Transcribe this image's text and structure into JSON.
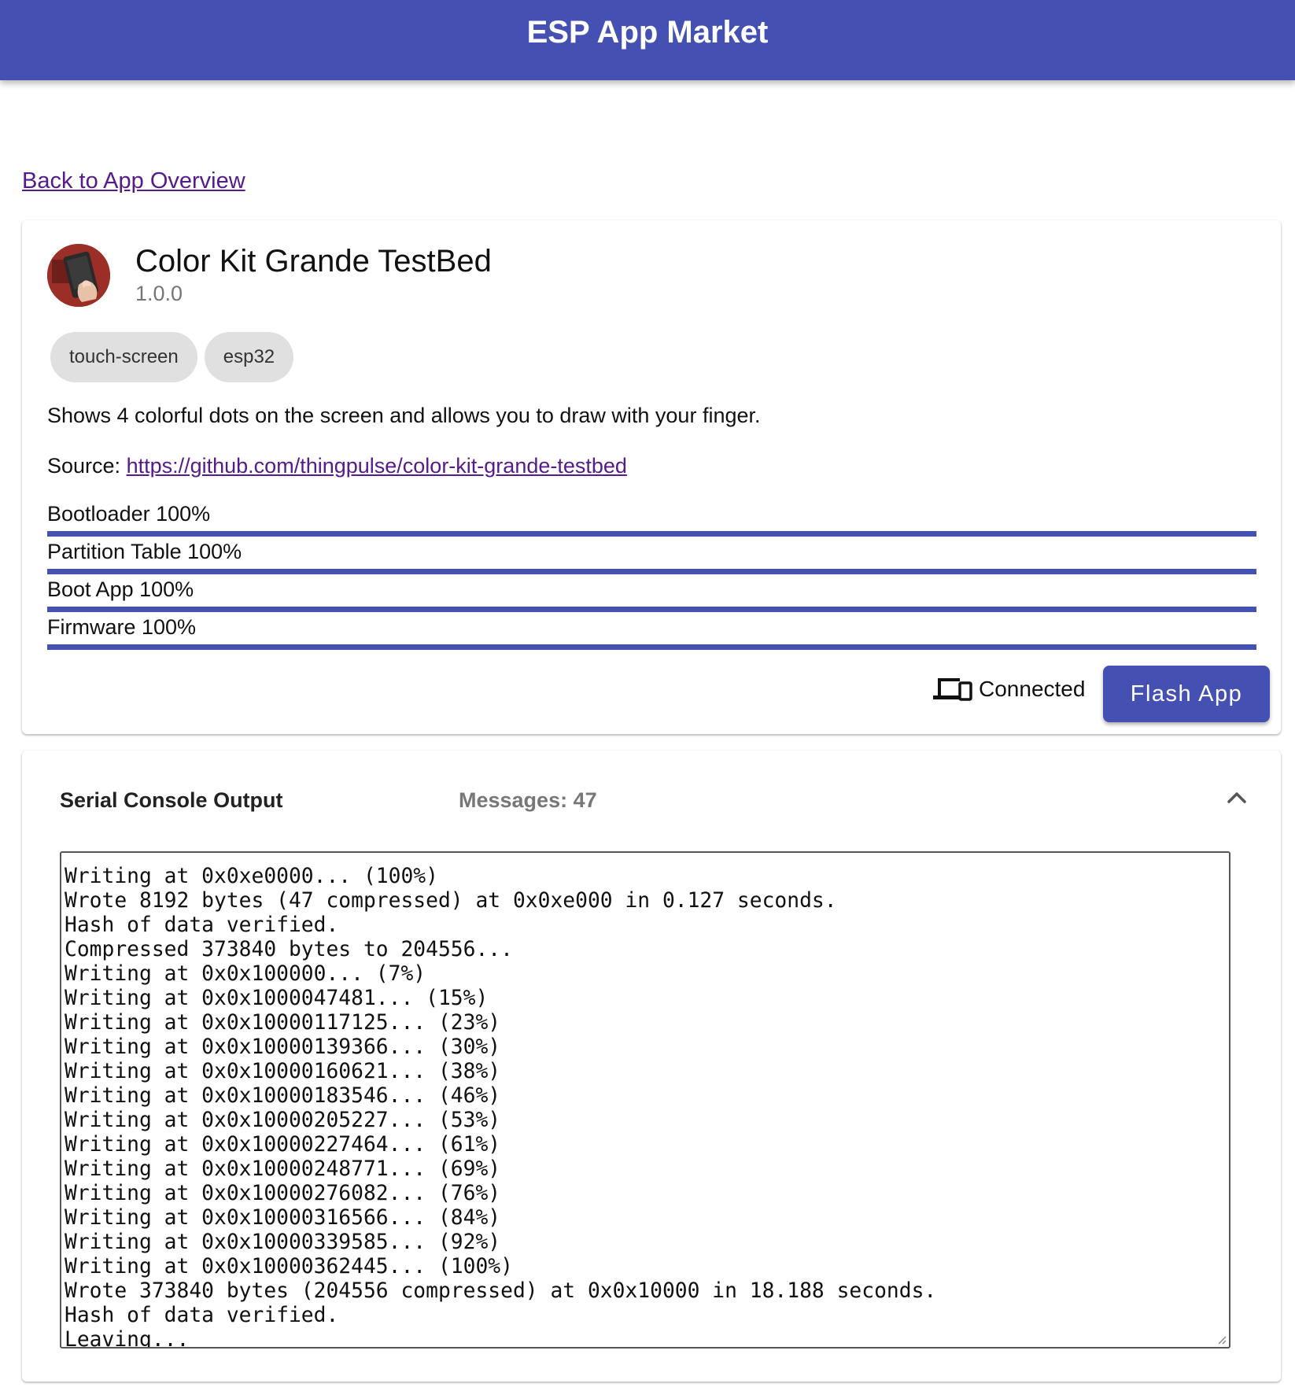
{
  "appbar": {
    "title": "ESP App Market"
  },
  "back_link": "Back to App Overview",
  "app": {
    "name": "Color Kit Grande TestBed",
    "version": "1.0.0",
    "tags": [
      "touch-screen",
      "esp32"
    ],
    "description": "Shows 4 colorful dots on the screen and allows you to draw with your finger.",
    "source_label": "Source:",
    "source_url": "https://github.com/thingpulse/color-kit-grande-testbed"
  },
  "progress": [
    {
      "label": "Bootloader 100%",
      "value": 1.0
    },
    {
      "label": "Partition Table 100%",
      "value": 1.0
    },
    {
      "label": "Boot App 100%",
      "value": 1.0
    },
    {
      "label": "Firmware 100%",
      "value": 1.0
    }
  ],
  "device": {
    "status": "Connected",
    "icon": "devices-icon"
  },
  "flash_button": "Flash App",
  "console": {
    "title": "Serial Console Output",
    "messages": "Messages: 47",
    "lines": [
      "Writing at 0x0xe0000... (100%)",
      "Wrote 8192 bytes (47 compressed) at 0x0xe000 in 0.127 seconds.",
      "Hash of data verified.",
      "Compressed 373840 bytes to 204556...",
      "Writing at 0x0x100000... (7%)",
      "Writing at 0x0x1000047481... (15%)",
      "Writing at 0x0x10000117125... (23%)",
      "Writing at 0x0x10000139366... (30%)",
      "Writing at 0x0x10000160621... (38%)",
      "Writing at 0x0x10000183546... (46%)",
      "Writing at 0x0x10000205227... (53%)",
      "Writing at 0x0x10000227464... (61%)",
      "Writing at 0x0x10000248771... (69%)",
      "Writing at 0x0x10000276082... (76%)",
      "Writing at 0x0x10000316566... (84%)",
      "Writing at 0x0x10000339585... (92%)",
      "Writing at 0x0x10000362445... (100%)",
      "Wrote 373840 bytes (204556 compressed) at 0x0x10000 in 18.188 seconds.",
      "Hash of data verified.",
      "Leaving..."
    ]
  },
  "colors": {
    "primary": "#4451b2",
    "link": "#551a8b",
    "chip": "#e0e0e0"
  }
}
